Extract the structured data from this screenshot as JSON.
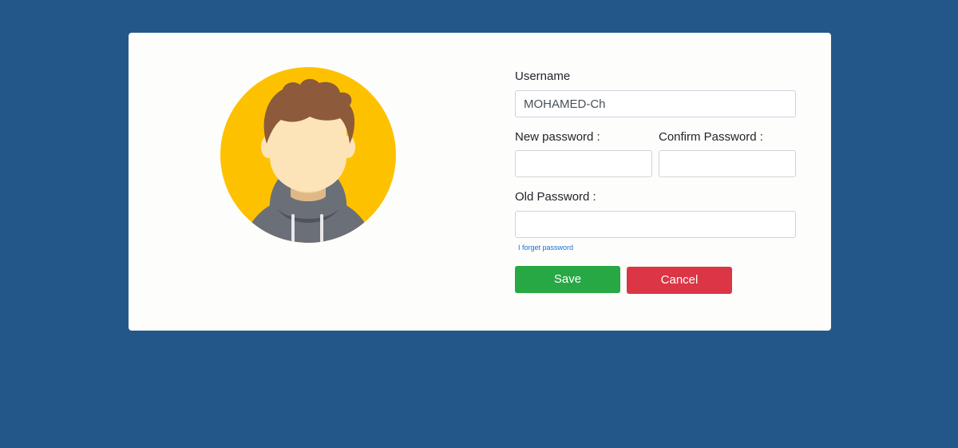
{
  "form": {
    "username_label": "Username",
    "username_value": "MOHAMED-Ch",
    "new_password_label": "New password :",
    "confirm_password_label": "Confirm Password :",
    "old_password_label": "Old Password :",
    "forgot_link": "I forget password",
    "save_label": "Save",
    "cancel_label": "Cancel"
  },
  "avatar": {
    "icon": "user-avatar-icon",
    "background_color": "#fec100"
  },
  "colors": {
    "page_background": "#245789",
    "card_background": "#fdfefc",
    "save_button": "#28a745",
    "cancel_button": "#dc3545",
    "link": "#1a6fd6"
  }
}
